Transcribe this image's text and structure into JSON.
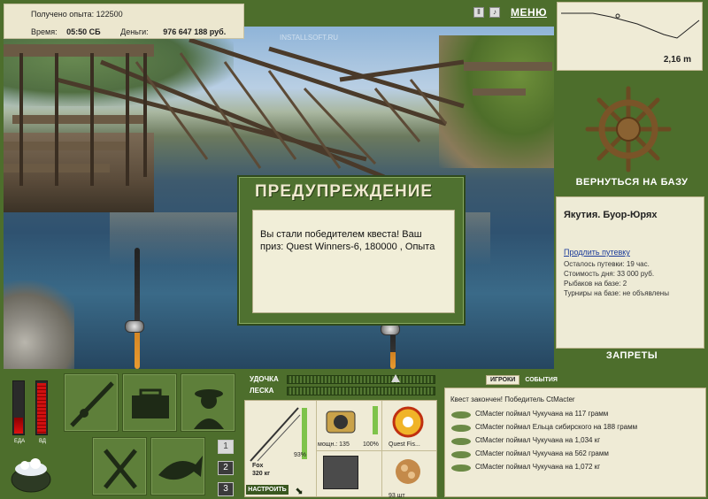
{
  "hud": {
    "experience_label": "Получено опыта:",
    "experience_value": "122500",
    "time_label": "Время:",
    "time_value": "05:50 СБ",
    "money_label": "Деньги:",
    "money_value": "976 647 188 руб."
  },
  "topbar": {
    "pause_icon": "pause-icon",
    "sound_icon": "sound-icon",
    "menu_label": "МЕНЮ"
  },
  "depth": {
    "value": "2,16 m"
  },
  "base": {
    "return_label": "ВЕРНУТЬСЯ НА БАЗУ",
    "location": "Якутия. Буор-Юрях",
    "extend_link": "Продлить путевку",
    "lines": [
      "Осталось путевки: 19 час.",
      "Стоимость дня: 33 000 руб.",
      "Рыбаков на базе: 2",
      "Турниры на базе: не объявлены"
    ],
    "bans_label": "ЗАПРЕТЫ"
  },
  "dialog": {
    "title": "ПРЕДУПРЕЖДЕНИЕ",
    "message": "Вы стали победителем квеста! Ваш приз: Quest Winners-6, 180000 , Опыта"
  },
  "meters": {
    "food_label": "ЕДА",
    "food_level": 0.3,
    "drink_label": "ВД",
    "drink_level": 0.95
  },
  "pages": [
    "1",
    "2",
    "3"
  ],
  "tackle": {
    "rod_label": "УДОЧКА",
    "line_label": "ЛЕСКА",
    "rod_name": "Fox",
    "rod_weight": "320 кг",
    "rod_condition": "93%",
    "reel_power": "мощн.: 135",
    "reel_condition": "100%",
    "line_name": "Quest Fis...",
    "bait_count": "93 шт",
    "configure_label": "НАСТРОИТЬ"
  },
  "events": {
    "tab_players": "ИГРОКИ",
    "tab_events": "СОБЫТИЯ",
    "header": "Квест закончен! Победитель CtMacter",
    "items": [
      "CtMacter поймал Чукучана на 117 грамм",
      "CtMacter поймал Ельца сибирского на 188 грамм",
      "CtMacter поймал Чукучана на 1,034 кг",
      "CtMacter поймал Чукучана на 562 грамм",
      "CtMacter поймал Чукучана на 1,072 кг"
    ]
  },
  "watermark": "INSTALLSOFT.RU"
}
